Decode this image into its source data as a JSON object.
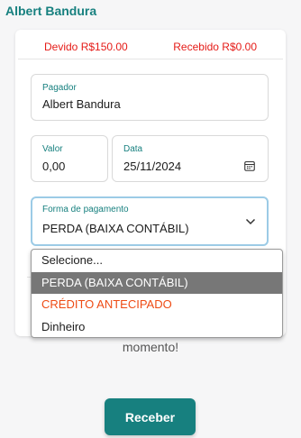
{
  "title": "Albert Bandura",
  "summary": {
    "devido": "Devido R$150.00",
    "recebido": "Recebido R$0.00"
  },
  "form": {
    "pagador": {
      "label": "Pagador",
      "value": "Albert Bandura"
    },
    "valor": {
      "label": "Valor",
      "value": "0,00"
    },
    "data": {
      "label": "Data",
      "value": "25/11/2024"
    },
    "forma": {
      "label": "Forma de pagamento",
      "value": "PERDA (BAIXA CONTÁBIL)"
    }
  },
  "dropdown": {
    "options": [
      "Selecione...",
      "PERDA (BAIXA CONTÁBIL)",
      "CRÉDITO ANTECIPADO",
      "Dinheiro"
    ],
    "selected_index": 1
  },
  "background_text": "momento!",
  "submit_label": "Receber",
  "colors": {
    "accent": "#17807f",
    "alert": "#e51b17",
    "option_highlight": "#777777",
    "option_orange": "#ee4b14"
  },
  "icons": [
    "calendar-icon",
    "chevron-down-icon"
  ]
}
